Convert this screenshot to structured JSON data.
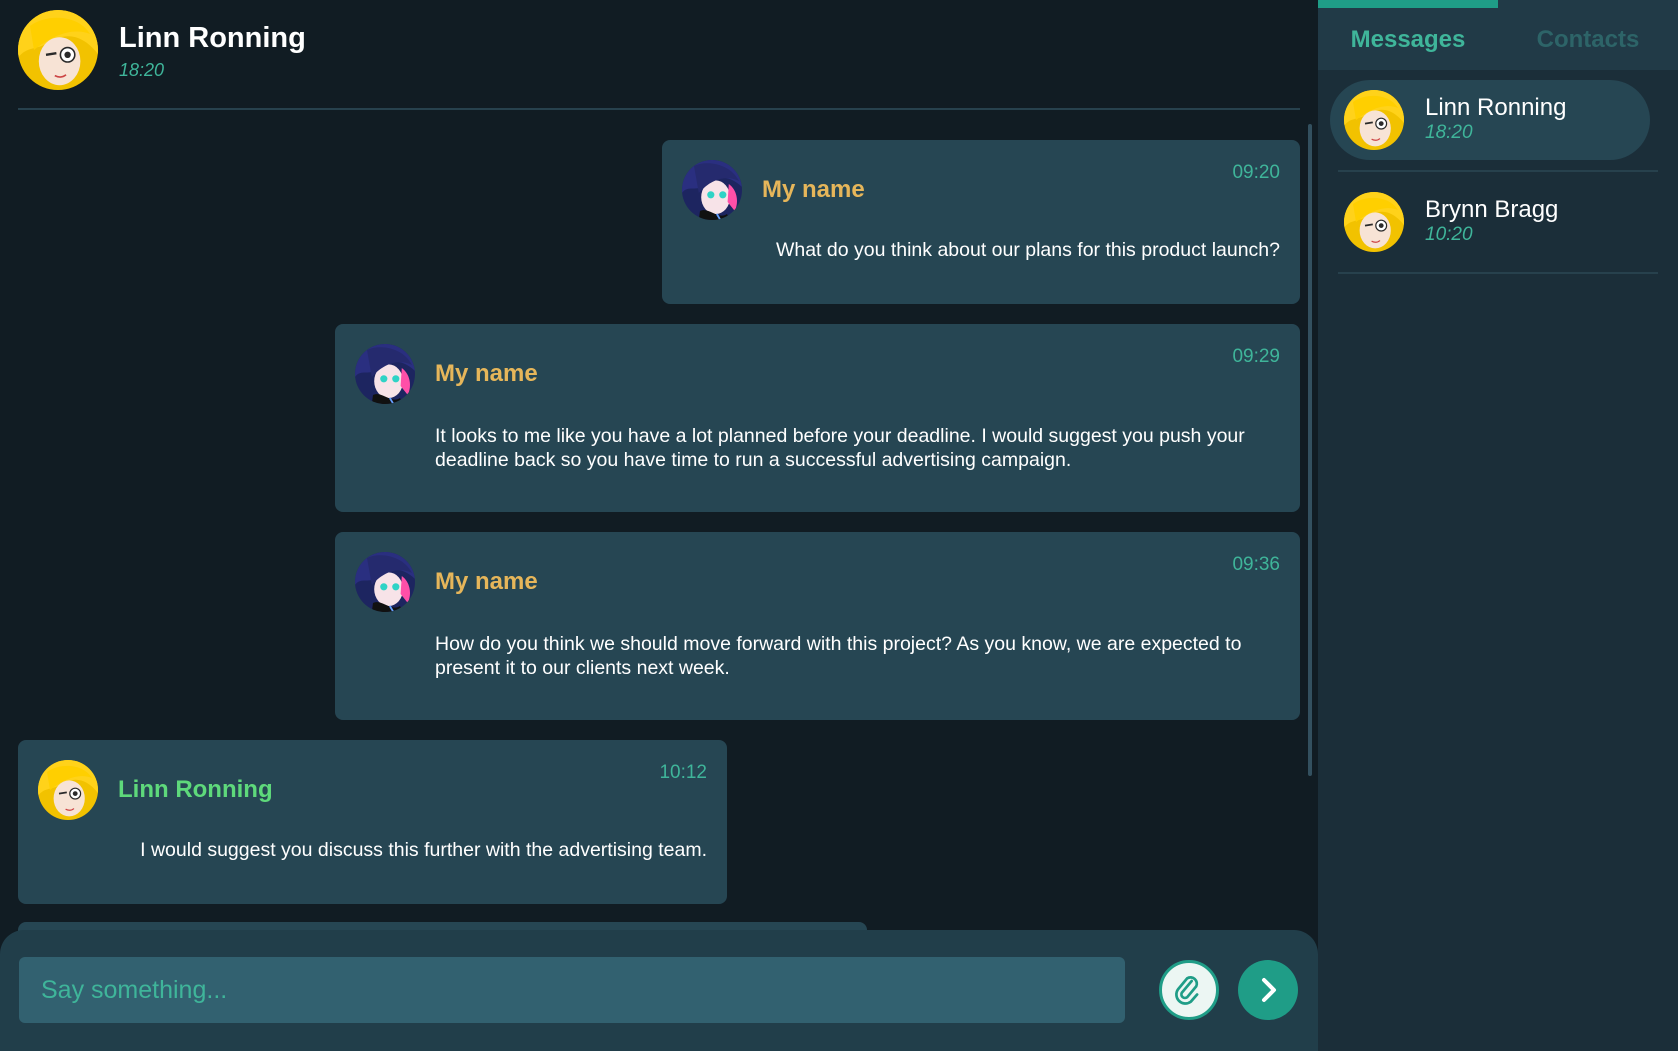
{
  "header": {
    "contact_name": "Linn Ronning",
    "last_seen": "18:20"
  },
  "messages": [
    {
      "sender": "My name",
      "time": "09:20",
      "text": "What do you think about our plans for this product launch?",
      "from_me": true
    },
    {
      "sender": "My name",
      "time": "09:29",
      "text": "It looks to me like you have a lot planned before your deadline. I would suggest you push your deadline back so you have time to run a successful advertising campaign.",
      "from_me": true
    },
    {
      "sender": "My name",
      "time": "09:36",
      "text": "How do you think we should move forward with this project? As you know, we are expected to present it to our clients next week.",
      "from_me": true
    },
    {
      "sender": "Linn Ronning",
      "time": "10:12",
      "text": "I would suggest you discuss this further with the advertising team.",
      "from_me": false
    }
  ],
  "composer": {
    "placeholder": "Say something...",
    "attach_icon": "paperclip-icon",
    "send_icon": "chevron-right-icon"
  },
  "sidebar": {
    "tabs": [
      {
        "label": "Messages",
        "active": true
      },
      {
        "label": "Contacts",
        "active": false
      }
    ],
    "conversations": [
      {
        "name": "Linn Ronning",
        "time": "18:20",
        "selected": true
      },
      {
        "name": "Brynn Bragg",
        "time": "10:20",
        "selected": false
      }
    ]
  },
  "colors": {
    "accent": "#1f9d87",
    "accent_text": "#3fb59a",
    "my_name": "#e6b65a",
    "their_name": "#5ed97b",
    "bubble": "#264653",
    "background": "#111c23"
  }
}
